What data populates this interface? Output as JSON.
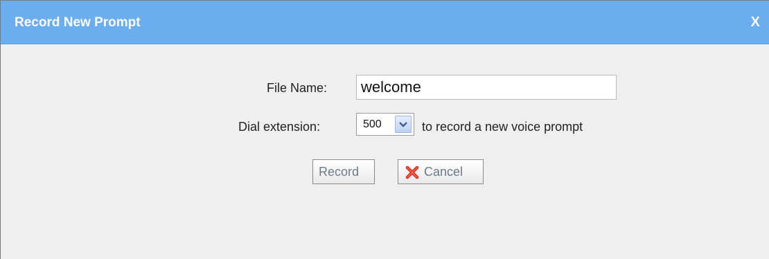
{
  "dialog": {
    "title": "Record New Prompt",
    "close_label": "X"
  },
  "form": {
    "file_name_label": "File Name:",
    "file_name_value": "welcome",
    "dial_label": "Dial extension:",
    "extension_selected": "500",
    "dial_suffix": "to record a new voice prompt"
  },
  "buttons": {
    "record_label": "Record",
    "cancel_label": "Cancel",
    "cancel_icon": "red-x-icon"
  },
  "colors": {
    "titlebar": "#6aaef0",
    "background": "#efefef",
    "cancel_icon": "#e02a1a"
  }
}
